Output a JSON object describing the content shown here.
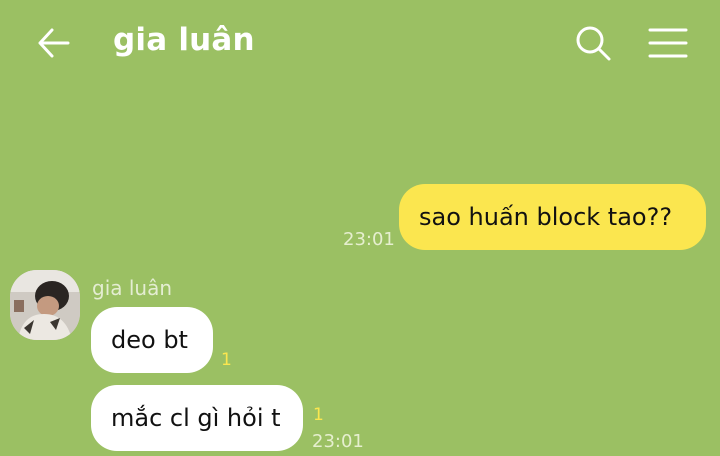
{
  "header": {
    "back_icon": "arrow-left-icon",
    "title": "gia luân",
    "search_icon": "search-icon",
    "menu_icon": "hamburger-menu-icon"
  },
  "colors": {
    "background": "#9bc063",
    "sent_bubble": "#fbe64f",
    "received_bubble": "#ffffff",
    "unread_count": "#fbe64f"
  },
  "messages": {
    "sent": [
      {
        "text": "sao huấn block tao??",
        "time": "23:01"
      }
    ],
    "received_group": {
      "sender": "gia luân",
      "avatar_icon": "user-avatar",
      "items": [
        {
          "text": "deo bt",
          "unread": "1"
        },
        {
          "text": "mắc cl gì hỏi t",
          "unread": "1",
          "time": "23:01"
        }
      ]
    }
  }
}
